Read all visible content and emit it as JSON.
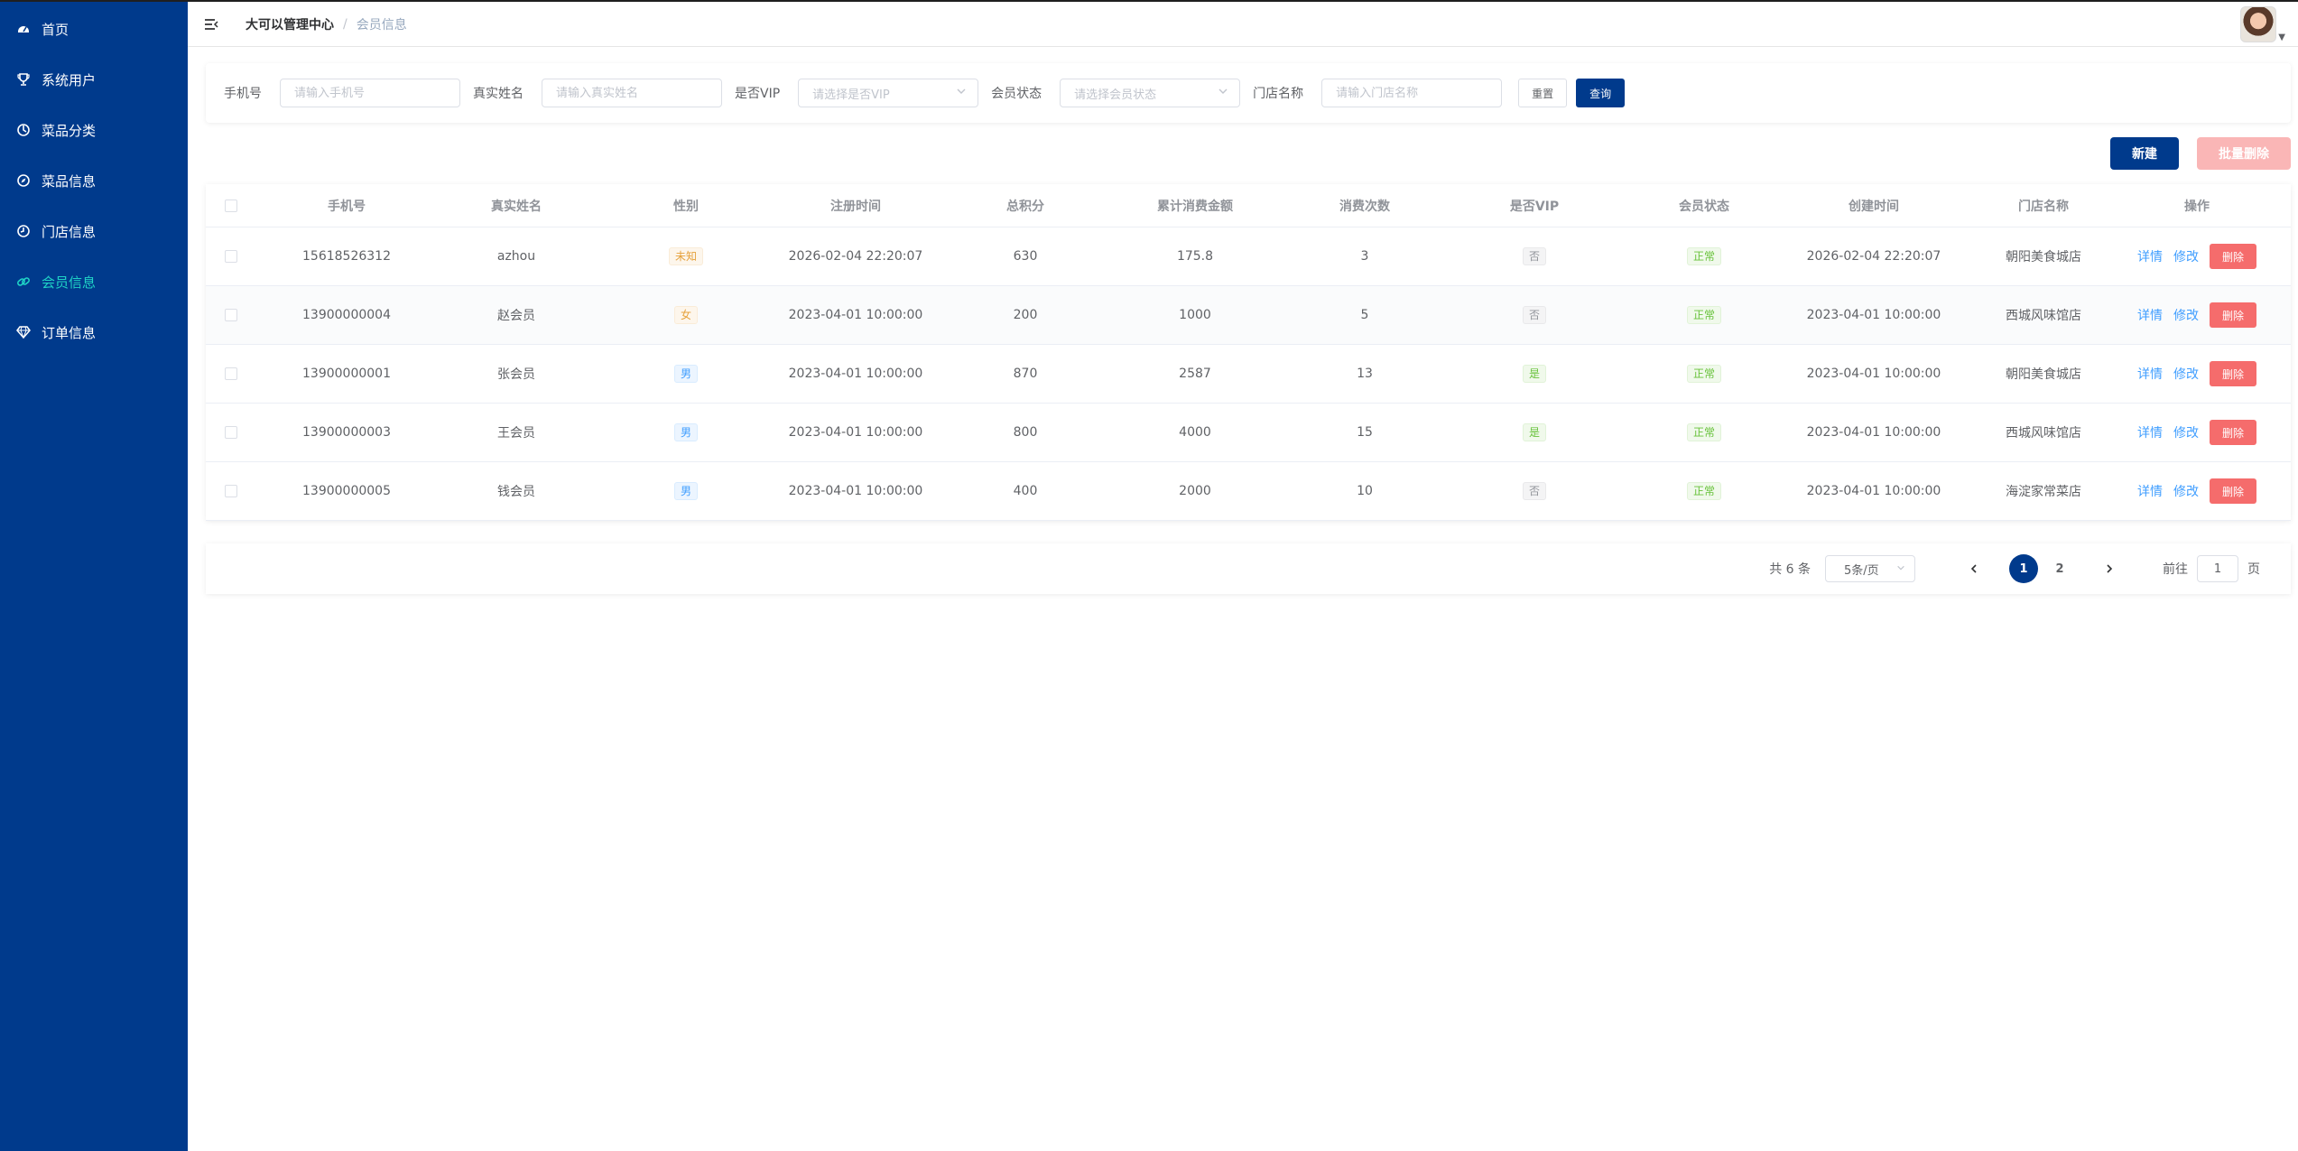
{
  "sidebar": {
    "items": [
      {
        "label": "首页",
        "icon": "dashboard-icon",
        "active": false
      },
      {
        "label": "系统用户",
        "icon": "trophy-icon",
        "active": false
      },
      {
        "label": "菜品分类",
        "icon": "category-icon",
        "active": false
      },
      {
        "label": "菜品信息",
        "icon": "compass-icon",
        "active": false
      },
      {
        "label": "门店信息",
        "icon": "clock-icon",
        "active": false
      },
      {
        "label": "会员信息",
        "icon": "link-icon",
        "active": true
      },
      {
        "label": "订单信息",
        "icon": "diamond-icon",
        "active": false
      }
    ]
  },
  "header": {
    "breadcrumb_home": "大可以管理中心",
    "breadcrumb_sep": "/",
    "breadcrumb_current": "会员信息"
  },
  "filters": {
    "phone_label": "手机号",
    "phone_placeholder": "请输入手机号",
    "name_label": "真实姓名",
    "name_placeholder": "请输入真实姓名",
    "vip_label": "是否VIP",
    "vip_placeholder": "请选择是否VIP",
    "status_label": "会员状态",
    "status_placeholder": "请选择会员状态",
    "store_label": "门店名称",
    "store_placeholder": "请输入门店名称",
    "reset_label": "重置",
    "search_label": "查询"
  },
  "actions": {
    "new_label": "新建",
    "batch_delete_label": "批量删除"
  },
  "table": {
    "columns": [
      "手机号",
      "真实姓名",
      "性别",
      "注册时间",
      "总积分",
      "累计消费金额",
      "消费次数",
      "是否VIP",
      "会员状态",
      "创建时间",
      "门店名称",
      "操作"
    ],
    "rows": [
      {
        "phone": "15618526312",
        "name": "azhou",
        "gender": "未知",
        "reg": "2026-02-04 22:20:07",
        "points": "630",
        "amount": "175.8",
        "count": "3",
        "vip": "否",
        "status": "正常",
        "created": "2026-02-04 22:20:07",
        "store": "朝阳美食城店"
      },
      {
        "phone": "13900000004",
        "name": "赵会员",
        "gender": "女",
        "reg": "2023-04-01 10:00:00",
        "points": "200",
        "amount": "1000",
        "count": "5",
        "vip": "否",
        "status": "正常",
        "created": "2023-04-01 10:00:00",
        "store": "西城风味馆店"
      },
      {
        "phone": "13900000001",
        "name": "张会员",
        "gender": "男",
        "reg": "2023-04-01 10:00:00",
        "points": "870",
        "amount": "2587",
        "count": "13",
        "vip": "是",
        "status": "正常",
        "created": "2023-04-01 10:00:00",
        "store": "朝阳美食城店"
      },
      {
        "phone": "13900000003",
        "name": "王会员",
        "gender": "男",
        "reg": "2023-04-01 10:00:00",
        "points": "800",
        "amount": "4000",
        "count": "15",
        "vip": "是",
        "status": "正常",
        "created": "2023-04-01 10:00:00",
        "store": "西城风味馆店"
      },
      {
        "phone": "13900000005",
        "name": "钱会员",
        "gender": "男",
        "reg": "2023-04-01 10:00:00",
        "points": "400",
        "amount": "2000",
        "count": "10",
        "vip": "否",
        "status": "正常",
        "created": "2023-04-01 10:00:00",
        "store": "海淀家常菜店"
      }
    ],
    "ops": {
      "detail": "详情",
      "edit": "修改",
      "delete": "删除"
    }
  },
  "pagination": {
    "total": "共 6 条",
    "page_size": "5条/页",
    "pages": [
      "1",
      "2"
    ],
    "current": "1",
    "jump_label": "前往",
    "jump_value": "1",
    "jump_suffix": "页"
  },
  "colors": {
    "primary": "#003a8c",
    "active_menu": "#1fd3c6",
    "danger": "#f56c6c"
  }
}
